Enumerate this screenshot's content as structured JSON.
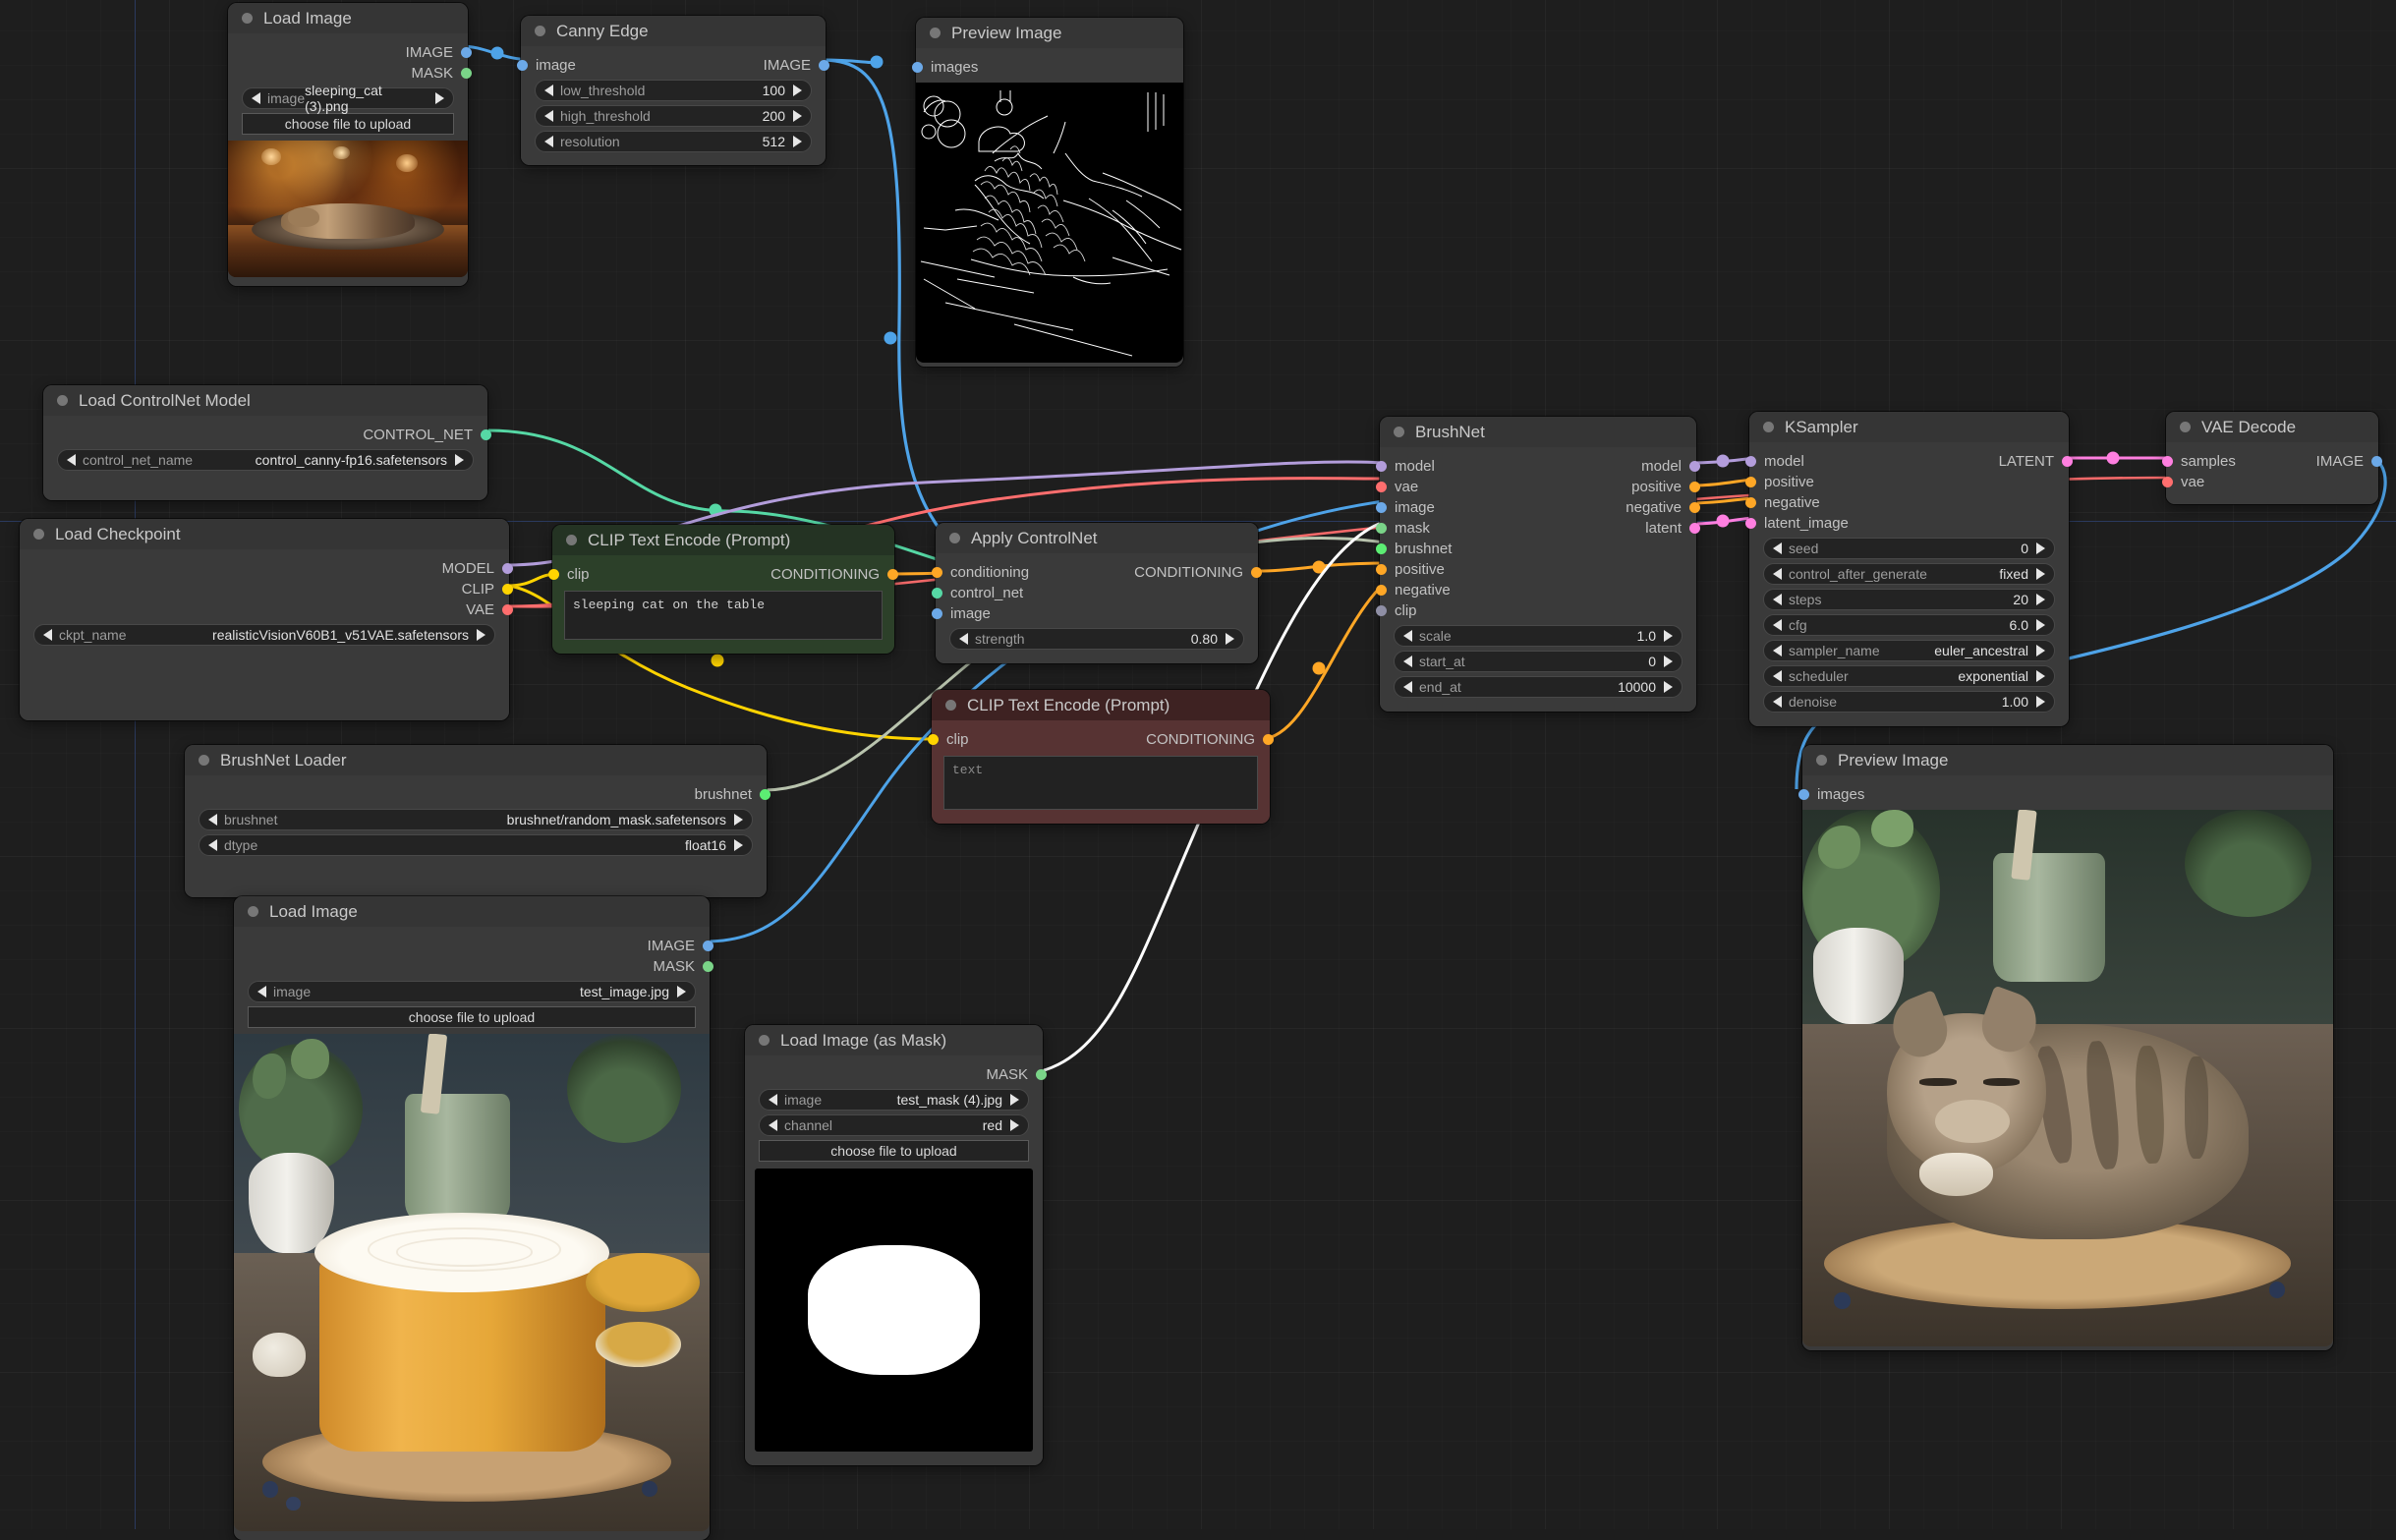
{
  "app": {
    "name": "ComfyUI",
    "canvas_background": "#1e1e1e"
  },
  "nodes": [
    {
      "id": "load_image_cat",
      "title": "Load Image",
      "outputs": [
        {
          "label": "IMAGE",
          "color": "#6ca9e8"
        },
        {
          "label": "MASK",
          "color": "#7ad488"
        }
      ],
      "widgets": [
        {
          "label": "image",
          "value": "sleeping_cat (3).png",
          "type": "combo"
        }
      ],
      "buttons": [
        "choose file to upload"
      ],
      "image_caption": "sleeping cat on a wooden table, warm bokeh lights"
    },
    {
      "id": "canny_edge",
      "title": "Canny Edge",
      "inputs": [
        {
          "label": "image",
          "color": "#6ca9e8"
        }
      ],
      "outputs": [
        {
          "label": "IMAGE",
          "color": "#6ca9e8"
        }
      ],
      "widgets": [
        {
          "label": "low_threshold",
          "value": "100"
        },
        {
          "label": "high_threshold",
          "value": "200"
        },
        {
          "label": "resolution",
          "value": "512"
        }
      ]
    },
    {
      "id": "preview_image_edges",
      "title": "Preview Image",
      "inputs": [
        {
          "label": "images",
          "color": "#6ca9e8"
        }
      ],
      "image_caption": "canny edge map of sleeping cat"
    },
    {
      "id": "load_controlnet_model",
      "title": "Load ControlNet Model",
      "outputs": [
        {
          "label": "CONTROL_NET",
          "color": "#56d8a5"
        }
      ],
      "widgets": [
        {
          "label": "control_net_name",
          "value": "control_canny-fp16.safetensors"
        }
      ]
    },
    {
      "id": "load_checkpoint",
      "title": "Load Checkpoint",
      "outputs": [
        {
          "label": "MODEL",
          "color": "#b39ddb"
        },
        {
          "label": "CLIP",
          "color": "#ffd400"
        },
        {
          "label": "VAE",
          "color": "#ff6e6e"
        }
      ],
      "widgets": [
        {
          "label": "ckpt_name",
          "value": "realisticVisionV60B1_v51VAE.safetensors"
        }
      ]
    },
    {
      "id": "clip_text_encode_positive",
      "title": "CLIP Text Encode (Prompt)",
      "color": "green",
      "inputs": [
        {
          "label": "clip",
          "color": "#ffd400"
        }
      ],
      "outputs": [
        {
          "label": "CONDITIONING",
          "color": "#ffa726"
        }
      ],
      "text_value": "sleeping cat on the table",
      "text_is_placeholder": false
    },
    {
      "id": "apply_controlnet",
      "title": "Apply ControlNet",
      "inputs": [
        {
          "label": "conditioning",
          "color": "#ffa726"
        },
        {
          "label": "control_net",
          "color": "#56d8a5"
        },
        {
          "label": "image",
          "color": "#6ca9e8"
        }
      ],
      "outputs": [
        {
          "label": "CONDITIONING",
          "color": "#ffa726"
        }
      ],
      "widgets": [
        {
          "label": "strength",
          "value": "0.80"
        }
      ]
    },
    {
      "id": "clip_text_encode_negative",
      "title": "CLIP Text Encode (Prompt)",
      "color": "red",
      "inputs": [
        {
          "label": "clip",
          "color": "#ffd400"
        }
      ],
      "outputs": [
        {
          "label": "CONDITIONING",
          "color": "#ffa726"
        }
      ],
      "text_value": "text",
      "text_is_placeholder": true
    },
    {
      "id": "brushnet",
      "title": "BrushNet",
      "inputs": [
        {
          "label": "model",
          "color": "#b39ddb"
        },
        {
          "label": "vae",
          "color": "#ff6e6e"
        },
        {
          "label": "image",
          "color": "#6ca9e8"
        },
        {
          "label": "mask",
          "color": "#7ad488"
        },
        {
          "label": "brushnet",
          "color": "#5ced73"
        },
        {
          "label": "positive",
          "color": "#ffa726"
        },
        {
          "label": "negative",
          "color": "#ffa726"
        },
        {
          "label": "clip",
          "color": "#8f8fa5"
        }
      ],
      "outputs": [
        {
          "label": "model",
          "color": "#b39ddb"
        },
        {
          "label": "positive",
          "color": "#ffa726"
        },
        {
          "label": "negative",
          "color": "#ffa726"
        },
        {
          "label": "latent",
          "color": "#ff7fe0"
        }
      ],
      "widgets": [
        {
          "label": "scale",
          "value": "1.0"
        },
        {
          "label": "start_at",
          "value": "0"
        },
        {
          "label": "end_at",
          "value": "10000"
        }
      ]
    },
    {
      "id": "ksampler",
      "title": "KSampler",
      "inputs": [
        {
          "label": "model",
          "color": "#b39ddb"
        },
        {
          "label": "positive",
          "color": "#ffa726"
        },
        {
          "label": "negative",
          "color": "#ffa726"
        },
        {
          "label": "latent_image",
          "color": "#ff7fe0"
        }
      ],
      "outputs": [
        {
          "label": "LATENT",
          "color": "#ff7fe0"
        }
      ],
      "widgets": [
        {
          "label": "seed",
          "value": "0"
        },
        {
          "label": "control_after_generate",
          "value": "fixed"
        },
        {
          "label": "steps",
          "value": "20"
        },
        {
          "label": "cfg",
          "value": "6.0"
        },
        {
          "label": "sampler_name",
          "value": "euler_ancestral"
        },
        {
          "label": "scheduler",
          "value": "exponential"
        },
        {
          "label": "denoise",
          "value": "1.00"
        }
      ]
    },
    {
      "id": "vae_decode",
      "title": "VAE Decode",
      "inputs": [
        {
          "label": "samples",
          "color": "#ff7fe0"
        },
        {
          "label": "vae",
          "color": "#ff6e6e"
        }
      ],
      "outputs": [
        {
          "label": "IMAGE",
          "color": "#6ca9e8"
        }
      ]
    },
    {
      "id": "brushnet_loader",
      "title": "BrushNet Loader",
      "outputs": [
        {
          "label": "brushnet",
          "color": "#5ced73"
        }
      ],
      "widgets": [
        {
          "label": "brushnet",
          "value": "brushnet/random_mask.safetensors"
        },
        {
          "label": "dtype",
          "value": "float16"
        }
      ]
    },
    {
      "id": "load_image_test",
      "title": "Load Image",
      "outputs": [
        {
          "label": "IMAGE",
          "color": "#6ca9e8"
        },
        {
          "label": "MASK",
          "color": "#7ad488"
        }
      ],
      "widgets": [
        {
          "label": "image",
          "value": "test_image.jpg"
        }
      ],
      "buttons": [
        "choose file to upload"
      ],
      "image_caption": "orange cake on wooden slice with plants and bowls"
    },
    {
      "id": "load_image_as_mask",
      "title": "Load Image (as Mask)",
      "outputs": [
        {
          "label": "MASK",
          "color": "#7ad488"
        }
      ],
      "widgets": [
        {
          "label": "image",
          "value": "test_mask (4).jpg"
        },
        {
          "label": "channel",
          "value": "red"
        }
      ],
      "buttons": [
        "choose file to upload"
      ],
      "image_caption": "black image with white rounded mask blob"
    },
    {
      "id": "preview_image_result",
      "title": "Preview Image",
      "inputs": [
        {
          "label": "images",
          "color": "#6ca9e8"
        }
      ],
      "image_caption": "sleeping tabby cat on wooden slice, inpainted result"
    }
  ],
  "link_colors": {
    "image": "#4ea3e8",
    "mask": "#b8c2b0",
    "model": "#b39ddb",
    "clip": "#ffd400",
    "vae": "#ff6e6e",
    "conditioning": "#ffa726",
    "control_net": "#56d8a5",
    "latent": "#ff7fe0",
    "brushnet": "#cfd8c8",
    "white": "#ffffff"
  }
}
